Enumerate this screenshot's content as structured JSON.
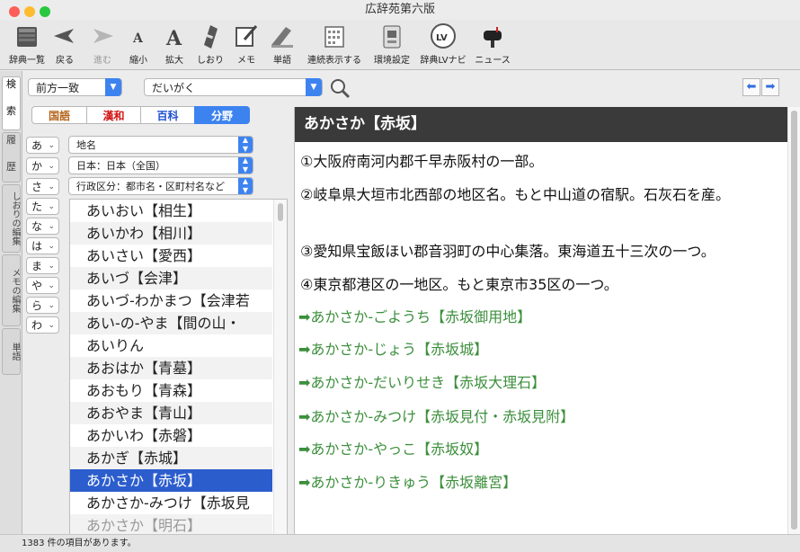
{
  "window": {
    "title": "広辞苑第六版"
  },
  "colors": {
    "accent": "#3d83f0",
    "selection": "#2c5dcd",
    "header": "#3a3a3a",
    "link": "#3c8f3c",
    "kokugo": "#b5651d",
    "kanwa": "#d21414",
    "hyakka": "#1e4fd0"
  },
  "toolbar": [
    {
      "label": "辞典一覧",
      "icon": "books-icon"
    },
    {
      "label": "戻る",
      "icon": "back-arrow-icon"
    },
    {
      "label": "進む",
      "icon": "forward-arrow-icon"
    },
    {
      "label": "縮小",
      "icon": "font-smaller-icon"
    },
    {
      "label": "拡大",
      "icon": "font-larger-icon"
    },
    {
      "label": "しおり",
      "icon": "bookmark-icon"
    },
    {
      "label": "メモ",
      "icon": "memo-icon"
    },
    {
      "label": "単語",
      "icon": "word-icon"
    },
    {
      "label": "連続表示する",
      "icon": "continuous-view-icon"
    },
    {
      "label": "環境設定",
      "icon": "preferences-icon"
    },
    {
      "label": "辞典LVナビ",
      "icon": "lv-navi-icon"
    },
    {
      "label": "ニュース",
      "icon": "mailbox-icon"
    }
  ],
  "vtabs": [
    "検",
    "索",
    "履",
    "歴",
    "しおりの編集",
    "メモの編集",
    "単語"
  ],
  "search": {
    "mode": "前方一致",
    "query": "だいがく"
  },
  "segments": [
    "国語",
    "漢和",
    "百科",
    "分野"
  ],
  "kana": [
    "あ",
    "か",
    "さ",
    "た",
    "な",
    "は",
    "ま",
    "や",
    "ら",
    "わ"
  ],
  "filters": [
    "地名",
    "日本：日本（全国）",
    "行政区分：都市名・区町村名など"
  ],
  "words": [
    "あいおい【相生】",
    "あいかわ【相川】",
    "あいさい【愛西】",
    "あいづ【会津】",
    "あいづ-わかまつ【会津若",
    "あい-の-やま【間の山・",
    "あいりん",
    "あおはか【青墓】",
    "あおもり【青森】",
    "あおやま【青山】",
    "あかいわ【赤磐】",
    "あかぎ【赤城】",
    "あかさか【赤坂】",
    "あかさか-みつけ【赤坂見",
    "あかさか【明石】"
  ],
  "article": {
    "heading": "あかさか【赤坂】",
    "definitions": [
      "①大阪府南河内郡千早赤阪村の一部。",
      "②岐阜県大垣市北西部の地区名。もと中山道の宿駅。石灰石を産。",
      "③愛知県宝飯ほい郡音羽町の中心集落。東海道五十三次の一つ。",
      "④東京都港区の一地区。もと東京市35区の一つ。"
    ],
    "links": [
      "あかさか-ごようち【赤坂御用地】",
      "あかさか-じょう【赤坂城】",
      "あかさか-だいりせき【赤坂大理石】",
      "あかさか-みつけ【赤坂見付・赤坂見附】",
      "あかさか-やっこ【赤坂奴】",
      "あかさか-りきゅう【赤坂離宮】"
    ]
  },
  "status": "1383 件の項目があります。"
}
